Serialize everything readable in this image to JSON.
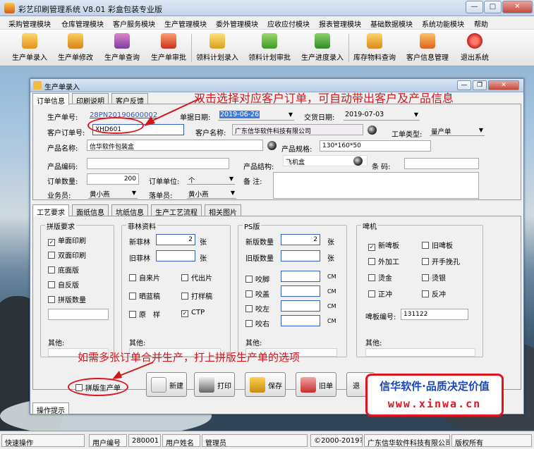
{
  "window": {
    "title": "彩艺印刷管理系统  V8.01 彩盒包装专业版"
  },
  "menu": [
    "采购管理模块",
    "仓库管理模块",
    "客户服务模块",
    "生产管理模块",
    "委外管理模块",
    "应收应付模块",
    "报表管理模块",
    "基础数据模块",
    "系统功能模块",
    "帮助"
  ],
  "toolbar": [
    "生产单录入",
    "生产单修改",
    "生产单查询",
    "生产单审批",
    "领料计划录入",
    "领料计划审批",
    "生产进度录入",
    "库存物料查询",
    "客户信息管理",
    "退出系统"
  ],
  "child": {
    "title": "生产单录入"
  },
  "tabs_top": [
    "订单信息",
    "印刷说明",
    "客户反馈"
  ],
  "form": {
    "order_no_label": "生产单号:",
    "order_no": "28PN20190600002",
    "date_label": "单据日期:",
    "date": "2019-06-26",
    "delivery_label": "交货日期:",
    "delivery": "2019-07-03",
    "cust_order_label": "客户订单号:",
    "cust_order": "XHD601",
    "cust_name_label": "客户名称:",
    "cust_name": "广东信华软件科技有限公司",
    "work_type_label": "工单类型:",
    "work_type": "量产单",
    "product_label": "产品名称:",
    "product": "信华软件包装盒",
    "spec_label": "产品规格:",
    "spec": "130*160*50",
    "code_label": "产品编码:",
    "code": "",
    "struct_label": "产品结构:",
    "struct": "飞机盒",
    "barcode_label": "条 码:",
    "barcode": "",
    "qty_label": "订单数量:",
    "qty": "200",
    "unit_label": "订单单位:",
    "unit": "个",
    "remark_label": "备 注:",
    "remark": "",
    "sales_label": "业务员:",
    "sales": "黄小燕",
    "clerk_label": "落单员:",
    "clerk": "黄小燕"
  },
  "tabs_bottom": [
    "工艺要求",
    "面纸信息",
    "坑纸信息",
    "生产工艺流程",
    "相关图片"
  ],
  "groups": {
    "g1": {
      "title": "拼版要求",
      "items": [
        {
          "label": "单面印刷",
          "checked": "✓"
        },
        {
          "label": "双面印刷",
          "checked": ""
        },
        {
          "label": "底面版",
          "checked": ""
        },
        {
          "label": "自反版",
          "checked": ""
        },
        {
          "label": "拼版数量",
          "checked": ""
        }
      ],
      "other": "其他:"
    },
    "g2": {
      "title": "菲林资料",
      "new_label": "新菲林",
      "new_val": "2",
      "old_label": "旧菲林",
      "old_val": "",
      "unit": "张",
      "checks": [
        {
          "label": "自来片",
          "checked": ""
        },
        {
          "label": "代出片",
          "checked": ""
        },
        {
          "label": "晒蓝稿",
          "checked": ""
        },
        {
          "label": "打样稿",
          "checked": ""
        },
        {
          "label": "原　样",
          "checked": ""
        },
        {
          "label": "CTP",
          "checked": "✓"
        }
      ],
      "other": "其他:"
    },
    "g3": {
      "title": "PS版",
      "new_label": "新版数量",
      "new_val": "2",
      "old_label": "旧版数量",
      "old_val": "",
      "unit": "张",
      "checks": [
        {
          "label": "咬脚",
          "unit": "CM"
        },
        {
          "label": "咬盖",
          "unit": "CM"
        },
        {
          "label": "咬左",
          "unit": "CM"
        },
        {
          "label": "咬右",
          "unit": "CM"
        }
      ],
      "other": "其他:"
    },
    "g4": {
      "title": "啤机",
      "checks": [
        {
          "label": "新啤板",
          "checked": "✓"
        },
        {
          "label": "旧啤板",
          "checked": ""
        },
        {
          "label": "外加工",
          "checked": ""
        },
        {
          "label": "开手挽孔",
          "checked": ""
        },
        {
          "label": "烫金",
          "checked": ""
        },
        {
          "label": "烫银",
          "checked": ""
        },
        {
          "label": "正冲",
          "checked": ""
        },
        {
          "label": "反冲",
          "checked": ""
        }
      ],
      "no_label": "啤板编号:",
      "no_val": "131122",
      "other": "其他:"
    }
  },
  "combine": {
    "label": "拼版生产单",
    "checked": ""
  },
  "buttons": [
    "新建",
    "打印",
    "保存",
    "旧单",
    "退"
  ],
  "tip_tab": "操作提示",
  "annotations": {
    "top": "双击选择对应客户订单，可自动带出客户及产品信息",
    "bottom": "如需多张订单合并生产，打上拼版生产单的选项"
  },
  "brand": {
    "line1": "信华软件·品质决定价值",
    "line2": "www.xinwa.cn"
  },
  "status": {
    "quick": "快速操作",
    "user_no_label": "用户编号",
    "user_no": "280001",
    "user_name_label": "用户姓名",
    "user_name": "管理员",
    "copyright": "©2000-2019?",
    "company": "广东信华软件科技有限公司",
    "rights": "版权所有"
  },
  "colors": {
    "annotation": "#d4161c",
    "brand_blue": "#1648b8",
    "link": "#3358c8"
  }
}
